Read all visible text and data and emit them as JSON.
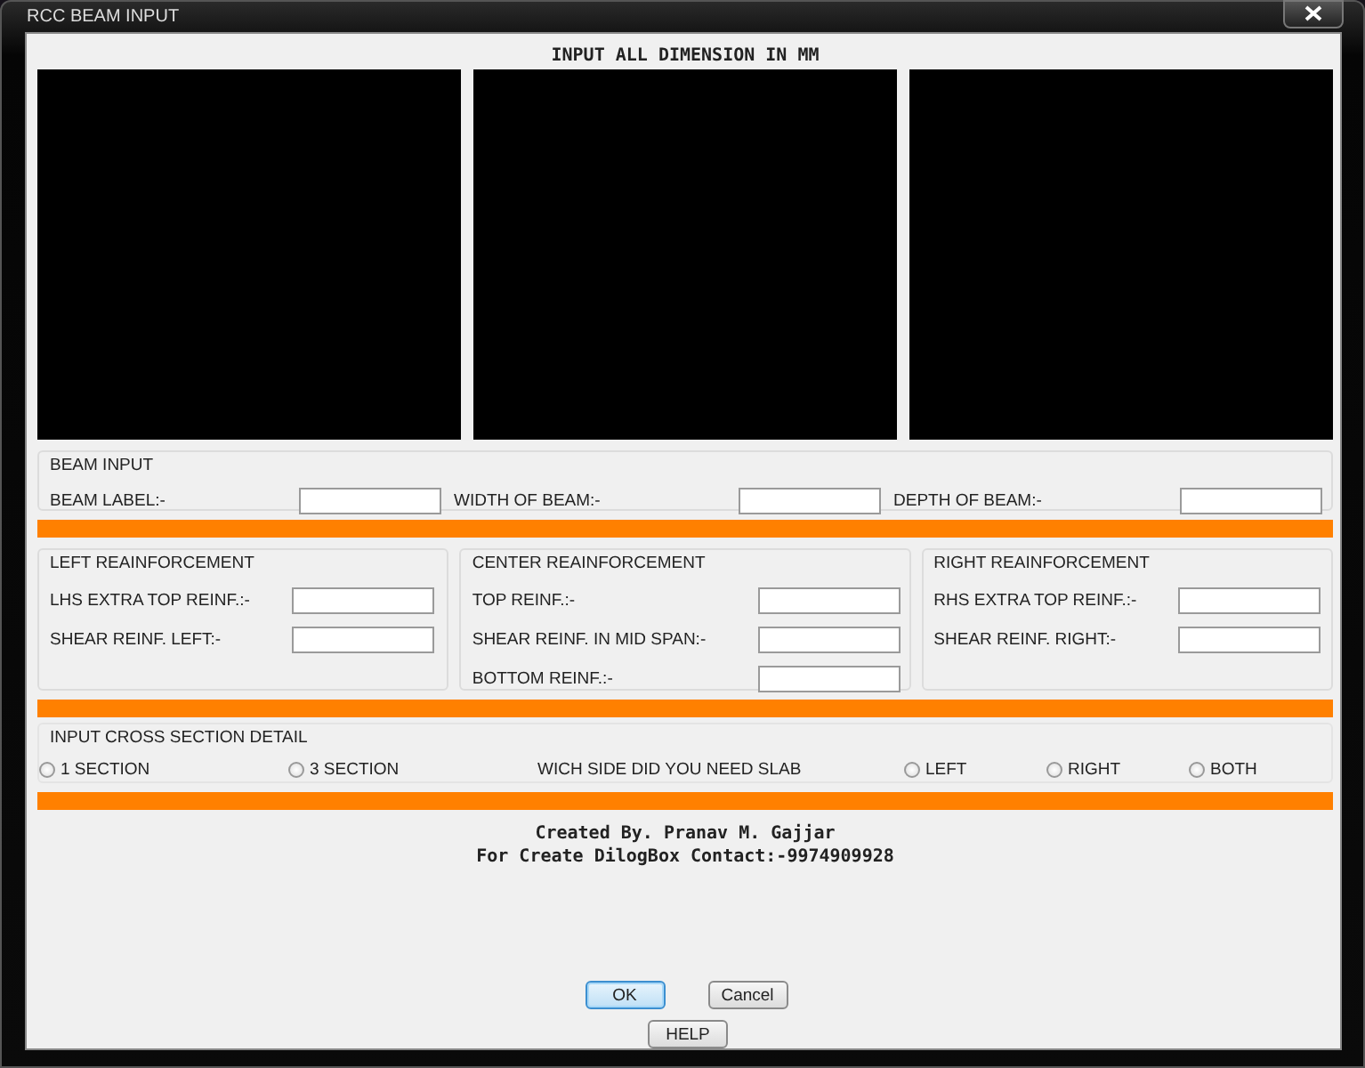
{
  "window": {
    "title": "RCC BEAM INPUT"
  },
  "heading": "INPUT ALL DIMENSION IN MM",
  "beam_input": {
    "title": "BEAM INPUT",
    "fields": [
      {
        "label": "BEAM LABEL:-"
      },
      {
        "label": "WIDTH OF BEAM:-"
      },
      {
        "label": "DEPTH OF BEAM:-"
      }
    ]
  },
  "reinforcement": [
    {
      "title": "LEFT REAINFORCEMENT",
      "fields": [
        {
          "label": "LHS EXTRA TOP REINF.:-"
        },
        {
          "label": "SHEAR REINF. LEFT:-"
        }
      ]
    },
    {
      "title": "CENTER REAINFORCEMENT",
      "fields": [
        {
          "label": "TOP REINF.:-"
        },
        {
          "label": "SHEAR REINF. IN MID SPAN:-"
        },
        {
          "label": "BOTTOM REINF.:-"
        }
      ]
    },
    {
      "title": "RIGHT REAINFORCEMENT",
      "fields": [
        {
          "label": "RHS EXTRA TOP REINF.:-"
        },
        {
          "label": "SHEAR REINF. RIGHT:-"
        }
      ]
    }
  ],
  "cross_section": {
    "title": "INPUT CROSS SECTION DETAIL",
    "options": [
      {
        "label": "1 SECTION",
        "selected": false
      },
      {
        "label": "3 SECTION",
        "selected": false
      }
    ],
    "slab_question": "WICH SIDE DID YOU NEED SLAB",
    "slab_options": [
      {
        "label": "LEFT",
        "selected": false
      },
      {
        "label": "RIGHT",
        "selected": false
      },
      {
        "label": "BOTH",
        "selected": false
      }
    ]
  },
  "credits": [
    "Created By. Pranav M. Gajjar",
    "For Create DilogBox Contact:-9974909928"
  ],
  "button_rows": [
    [
      {
        "label": "OK",
        "default": true
      },
      {
        "label": "Cancel",
        "default": false
      }
    ],
    [
      {
        "label": "HELP",
        "default": false
      }
    ]
  ]
}
